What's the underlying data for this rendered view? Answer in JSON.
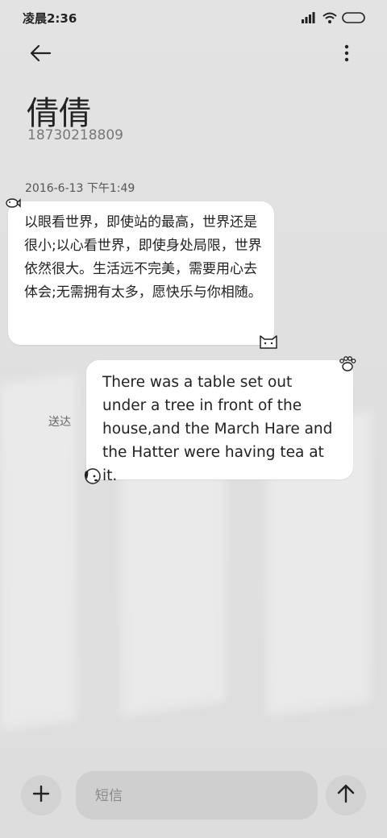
{
  "status_bar": {
    "time": "凌晨2:36",
    "icons": [
      "signal-icon",
      "wifi-icon",
      "battery-icon"
    ]
  },
  "header": {
    "back_icon": "back-arrow-icon",
    "more_icon": "more-vertical-icon"
  },
  "contact": {
    "name": "倩倩",
    "number": "18730218809"
  },
  "conversation": {
    "date": "2016-6-13 下午1:49",
    "messages": [
      {
        "direction": "incoming",
        "text": "以眼看世界，即使站的最高，世界还是很小;以心看世界，即使身处局限，世界依然很大。生活远不完美，需要用心去体会;无需拥有太多，愿快乐与你相随。"
      },
      {
        "direction": "outgoing",
        "text": "There was a table set out under a tree in front of the house,and the March Hare and the Hatter were having tea at it.",
        "status": "送达"
      }
    ]
  },
  "composer": {
    "placeholder": "短信",
    "add_icon": "plus-icon",
    "send_icon": "send-arrow-up-icon"
  },
  "colors": {
    "background": "#e0e0e0",
    "bubble": "#ffffff",
    "button": "#d2d2d2"
  }
}
